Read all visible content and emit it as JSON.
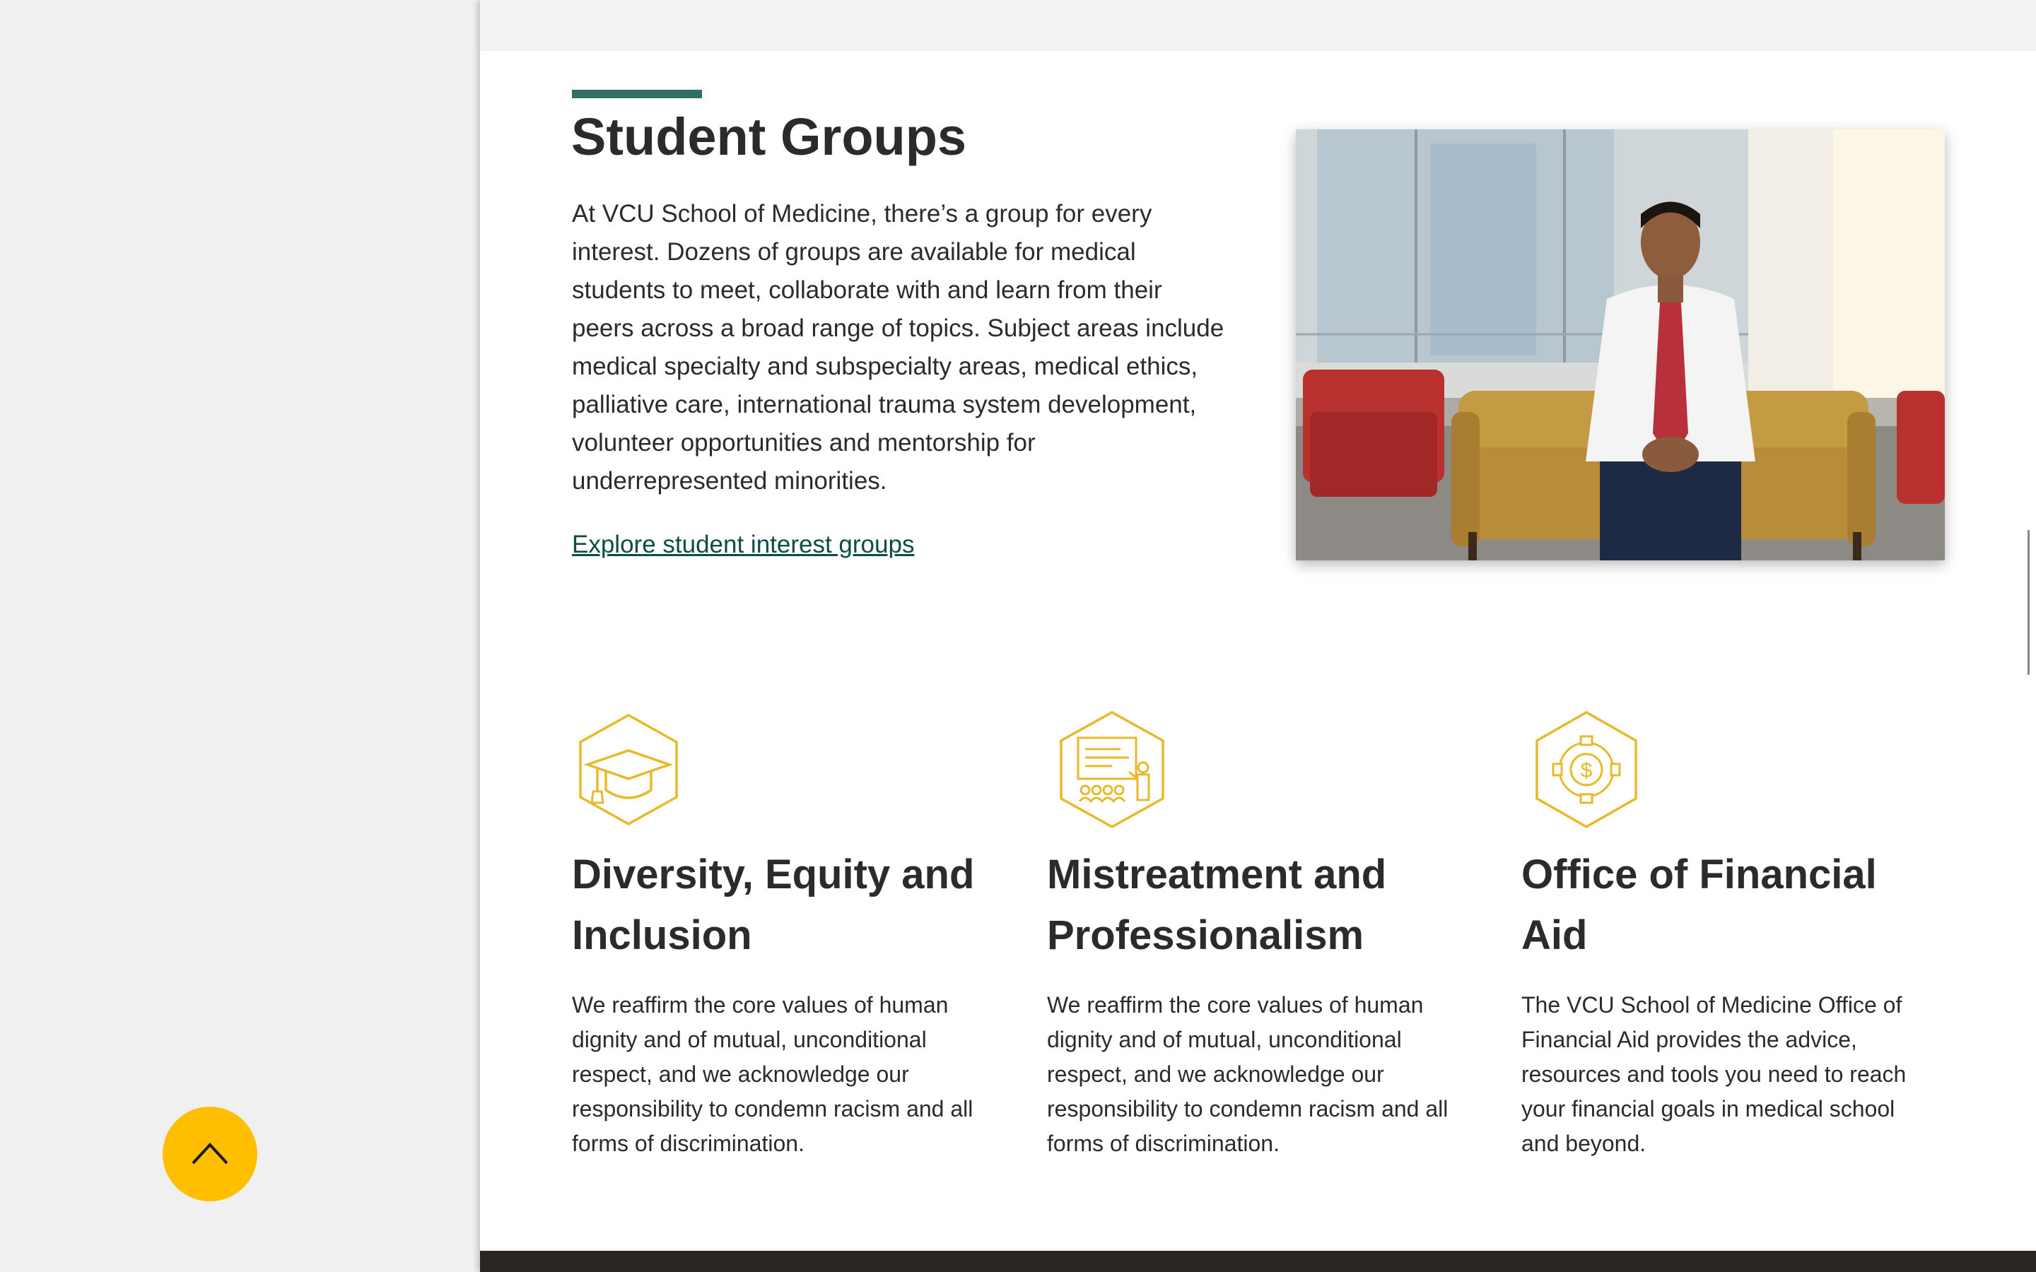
{
  "student_groups": {
    "heading": "Student Groups",
    "body": "At VCU School of Medicine, there’s a group for every interest. Dozens of groups are available for medical students to meet, collaborate with and learn from their peers across a broad range of topics. Subject areas include medical specialty and subspecialty areas, medical ethics, palliative care, international trauma system development, volunteer opportunities and mentorship for underrepresented minorities.",
    "link_label": "Explore student interest groups",
    "photo_icon": "student-in-white-coat-photo"
  },
  "cards": [
    {
      "icon": "graduation-cap-icon",
      "title": "Diversity, Equity and Inclusion",
      "body": "We reaffirm the core values of human dignity and of mutual, unconditional respect, and we acknowledge our responsibility to condemn racism and all forms of discrimination."
    },
    {
      "icon": "presentation-audience-icon",
      "title": "Mistreatment and Professionalism",
      "body": "We reaffirm the core values of human dignity and of mutual, unconditional respect, and we acknowledge our responsibility to condemn racism and all forms of discrimination."
    },
    {
      "icon": "dollar-gear-icon",
      "title": "Office of Financial Aid",
      "body": "The VCU School of Medicine Office of Financial Aid provides the advice, resources and tools you need to reach your financial goals in medical school and beyond."
    }
  ],
  "back_to_top": {
    "icon": "chevron-up-icon"
  },
  "colors": {
    "accent_teal": "#2f6f66",
    "link_green": "#0d4d45",
    "icon_gold": "#e8b92a",
    "button_yellow": "#ffbf00"
  }
}
